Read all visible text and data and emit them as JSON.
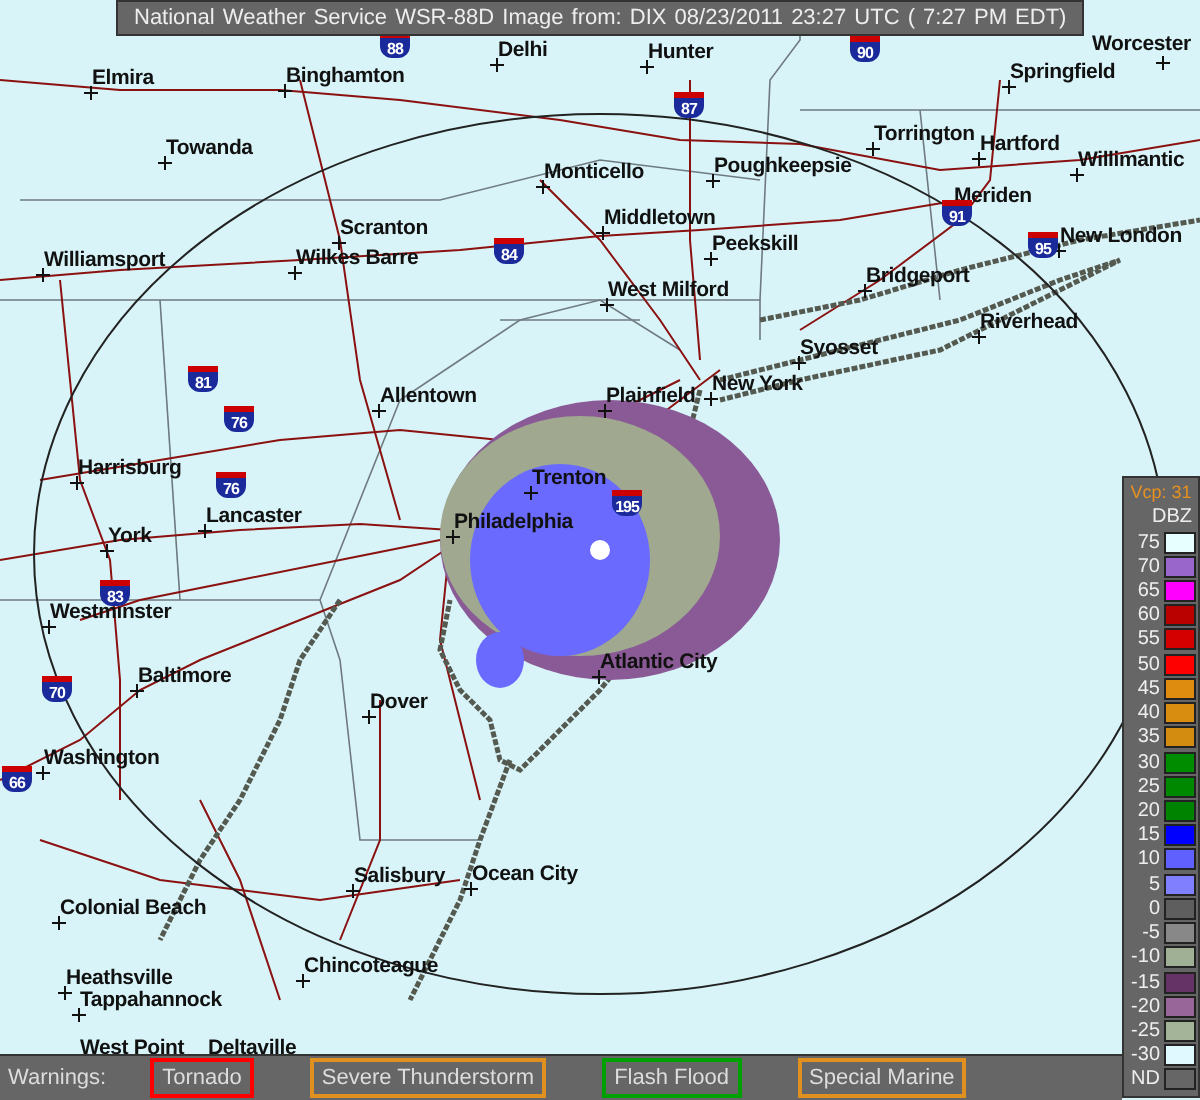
{
  "title": "National Weather Service WSR-88D Image from: DIX 08/23/2011 23:27 UTC ( 7:27 PM EDT)",
  "map": {
    "cities": [
      "Elmira",
      "Binghamton",
      "Delhi",
      "Hunter",
      "Worcester",
      "Springfield",
      "Towanda",
      "Torrington",
      "Hartford",
      "Monticello",
      "Poughkeepsie",
      "Willimantic",
      "Meriden",
      "Scranton",
      "Middletown",
      "New London",
      "Peekskill",
      "Williamsport",
      "Wilkes Barre",
      "West Milford",
      "Bridgeport",
      "Riverhead",
      "Syosset",
      "Plainfield",
      "New York",
      "Allentown",
      "Harrisburg",
      "Trenton",
      "Lancaster",
      "Philadelphia",
      "York",
      "Westminster",
      "Atlantic City",
      "Baltimore",
      "Dover",
      "Washington",
      "Salisbury",
      "Ocean City",
      "Colonial Beach",
      "Chincoteague",
      "Heathsville",
      "Tappahannock",
      "West Point",
      "Deltaville"
    ],
    "highway_shields": [
      "88",
      "90",
      "87",
      "84",
      "81",
      "76",
      "76",
      "195",
      "83",
      "70",
      "66",
      "91",
      "95"
    ]
  },
  "legend": {
    "mode": "Vcp: 31",
    "unit": "DBZ",
    "levels": [
      {
        "label": "75",
        "color": "#e8ffff"
      },
      {
        "label": "70",
        "color": "#9966cc"
      },
      {
        "label": "65",
        "color": "#ff00ff"
      },
      {
        "label": "60",
        "color": "#bb0000"
      },
      {
        "label": "55",
        "color": "#d40000"
      },
      {
        "label": "50",
        "color": "#ff0000"
      },
      {
        "label": "45",
        "color": "#dd8c10"
      },
      {
        "label": "40",
        "color": "#d88c10"
      },
      {
        "label": "35",
        "color": "#d48c10"
      },
      {
        "label": "30",
        "color": "#008c00"
      },
      {
        "label": "25",
        "color": "#008800"
      },
      {
        "label": "20",
        "color": "#008400"
      },
      {
        "label": "15",
        "color": "#0000ff"
      },
      {
        "label": "10",
        "color": "#6060ff"
      },
      {
        "label": "5",
        "color": "#8080ff"
      },
      {
        "label": "0",
        "color": "#5e5e5e"
      },
      {
        "label": "-5",
        "color": "#888888"
      },
      {
        "label": "-10",
        "color": "#a0b094"
      },
      {
        "label": "-15",
        "color": "#663366"
      },
      {
        "label": "-20",
        "color": "#996699"
      },
      {
        "label": "-25",
        "color": "#a4b498"
      },
      {
        "label": "-30",
        "color": "#e0f8ff"
      },
      {
        "label": "ND",
        "color": "#666666"
      }
    ]
  },
  "warnings": {
    "label": "Warnings:",
    "items": [
      {
        "label": "Tornado",
        "color": "#ff0000"
      },
      {
        "label": "Severe Thunderstorm",
        "color": "#e09020"
      },
      {
        "label": "Flash Flood",
        "color": "#00a000"
      },
      {
        "label": "Special Marine",
        "color": "#e09020"
      }
    ]
  }
}
